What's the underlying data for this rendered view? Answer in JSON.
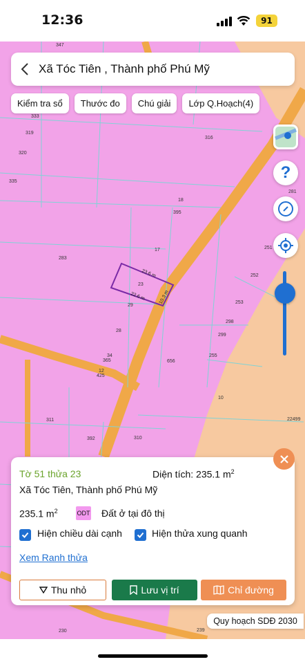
{
  "status": {
    "time": "12:36",
    "battery": "91"
  },
  "search": {
    "title": "Xã Tóc Tiên , Thành phố Phú Mỹ"
  },
  "chips": [
    "Kiểm tra sổ",
    "Thước đo",
    "Chú giải",
    "Lớp Q.Hoạch(4)"
  ],
  "map": {
    "parcel_numbers": [
      "347",
      "333",
      "319",
      "316",
      "320",
      "335",
      "18",
      "395",
      "17",
      "283",
      "252",
      "23",
      "29",
      "253",
      "28",
      "298",
      "299",
      "34",
      "365",
      "656",
      "255",
      "12",
      "425",
      "10",
      "311",
      "392",
      "310",
      "22499",
      "230",
      "239",
      "251",
      "281"
    ],
    "edge_lengths": [
      "23.6 m",
      "22.6 m",
      "10.3 m"
    ]
  },
  "controls": {
    "help": "?",
    "zoom_level": 0.25
  },
  "panel": {
    "parcel_id": "Tờ 51 thửa 23",
    "area_label": "Diện tích: 235.1 m",
    "area_sup": "2",
    "address": "Xã Tóc Tiên, Thành phố Phú Mỹ",
    "area_value": "235.1 m",
    "area_value_sup": "2",
    "zone_code": "ODT",
    "land_type": "Đất ở tại đô thị",
    "check_edges": "Hiện chiều dài cạnh",
    "check_neighbors": "Hiện thửa xung quanh",
    "link": "Xem Ranh thửa",
    "btn_minimize": "Thu nhỏ",
    "btn_save": "Lưu vị trí",
    "btn_route": "Chỉ đường"
  },
  "plan_tag": "Quy hoạch SDĐ 2030",
  "colors": {
    "urban_land": "#f2a3e8",
    "road": "#f0a848",
    "agri_land": "#f7c9a0",
    "accent_blue": "#1f6fd1",
    "save_green": "#1a7a4a",
    "route_orange": "#ef8f54"
  }
}
